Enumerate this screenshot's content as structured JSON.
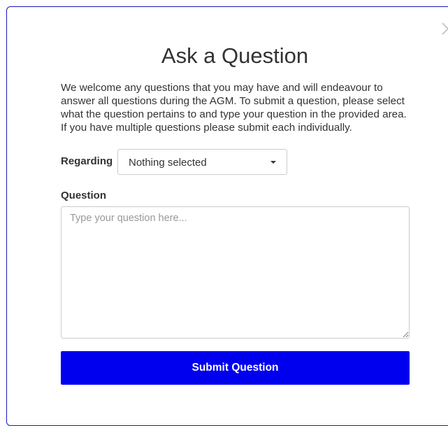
{
  "modal": {
    "title": "Ask a Question",
    "intro": "We welcome any questions that you may have and will endeavour to answer all questions during the AGM. To submit a question, please select what the question pertains to and type your question in the provided area. If you have multiple questions please submit each individually.",
    "close_icon": "close-icon"
  },
  "form": {
    "regarding_label": "Regarding",
    "regarding_selected": "Nothing selected",
    "question_label": "Question",
    "question_placeholder": "Type your question here...",
    "question_value": "",
    "submit_label": "Submit Question"
  },
  "colors": {
    "accent": "#0000ee",
    "modal_border": "#1a1ab8",
    "text": "#333333",
    "input_border": "#cccccc",
    "placeholder": "#999999"
  }
}
